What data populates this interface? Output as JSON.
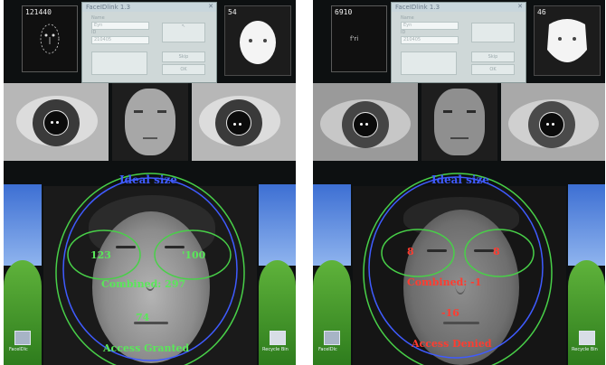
{
  "colors": {
    "ellipse_green": "#48d048",
    "ideal_blue": "#3f5bff",
    "granted_green": "#5ae85a",
    "denied_red": "#ff3c30"
  },
  "dialog": {
    "title": "FaceIDlink 1.3",
    "name_label": "Name",
    "name_value": "Eyn",
    "id_label": "ID",
    "id_value": "210405",
    "skip_button": "Skip",
    "ok_button": "OK"
  },
  "left": {
    "thumb_code": "121440",
    "silhouette_code": "54",
    "ideal_label": "Ideal size",
    "left_eye_score": "123",
    "right_eye_score": "'100",
    "combined": "Combined: 297",
    "face_score": "74",
    "status": "Access Granted",
    "status_color": "#5ae85a"
  },
  "right": {
    "thumb_code": "6910",
    "thumb_inner": "f'ri",
    "silhouette_code": "46",
    "ideal_label": "Ideal size",
    "left_eye_score": "8",
    "right_eye_score": "8",
    "combined": "Combined: -1",
    "face_score": "-16",
    "status": "Access Denied",
    "status_color": "#ff3c30"
  },
  "desktop": {
    "icon1_label": "FaceIDlc",
    "icon2_label": "Recycle Bin"
  }
}
